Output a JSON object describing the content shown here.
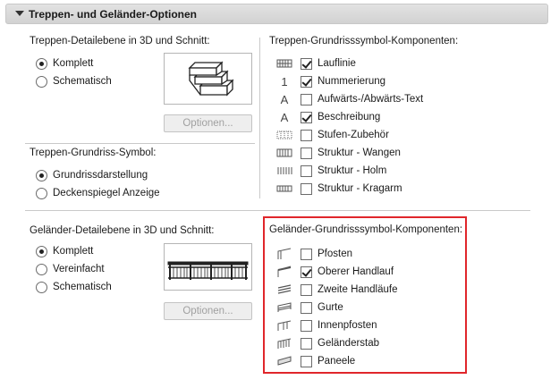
{
  "panel": {
    "title": "Treppen- und Geländer-Optionen"
  },
  "stair_detail": {
    "label": "Treppen-Detailebene in 3D und Schnitt:",
    "options": [
      {
        "label": "Komplett",
        "selected": true
      },
      {
        "label": "Schematisch",
        "selected": false
      }
    ],
    "button": "Optionen..."
  },
  "stair_symbol": {
    "label": "Treppen-Grundriss-Symbol:",
    "options": [
      {
        "label": "Grundrissdarstellung",
        "selected": true
      },
      {
        "label": "Deckenspiegel Anzeige",
        "selected": false
      }
    ]
  },
  "stair_components": {
    "label": "Treppen-Grundrisssymbol-Komponenten:",
    "items": [
      {
        "icon": "walking-line-icon",
        "label": "Lauflinie",
        "checked": true
      },
      {
        "icon": "numbering-icon",
        "label": "Nummerierung",
        "checked": true
      },
      {
        "icon": "text-a-icon",
        "label": "Aufwärts-/Abwärts-Text",
        "checked": false
      },
      {
        "icon": "text-a-icon",
        "label": "Beschreibung",
        "checked": true
      },
      {
        "icon": "tread-accessory-icon",
        "label": "Stufen-Zubehör",
        "checked": false
      },
      {
        "icon": "stringer-icon",
        "label": "Struktur - Wangen",
        "checked": false
      },
      {
        "icon": "beam-icon",
        "label": "Struktur - Holm",
        "checked": false
      },
      {
        "icon": "cantilever-icon",
        "label": "Struktur - Kragarm",
        "checked": false
      }
    ]
  },
  "railing_detail": {
    "label": "Geländer-Detailebene in 3D und Schnitt:",
    "options": [
      {
        "label": "Komplett",
        "selected": true
      },
      {
        "label": "Vereinfacht",
        "selected": false
      },
      {
        "label": "Schematisch",
        "selected": false
      }
    ],
    "button": "Optionen..."
  },
  "railing_components": {
    "label": "Geländer-Grundrisssymbol-Komponenten:",
    "highlight_color": "#e0262b",
    "items": [
      {
        "icon": "post-icon",
        "label": "Pfosten",
        "checked": false
      },
      {
        "icon": "top-rail-icon",
        "label": "Oberer Handlauf",
        "checked": true
      },
      {
        "icon": "handrails-icon",
        "label": "Zweite Handläufe",
        "checked": false
      },
      {
        "icon": "rail-icon",
        "label": "Gurte",
        "checked": false
      },
      {
        "icon": "inner-post-icon",
        "label": "Innenpfosten",
        "checked": false
      },
      {
        "icon": "baluster-icon",
        "label": "Geländerstab",
        "checked": false
      },
      {
        "icon": "panel-icon",
        "label": "Paneele",
        "checked": false
      }
    ]
  }
}
